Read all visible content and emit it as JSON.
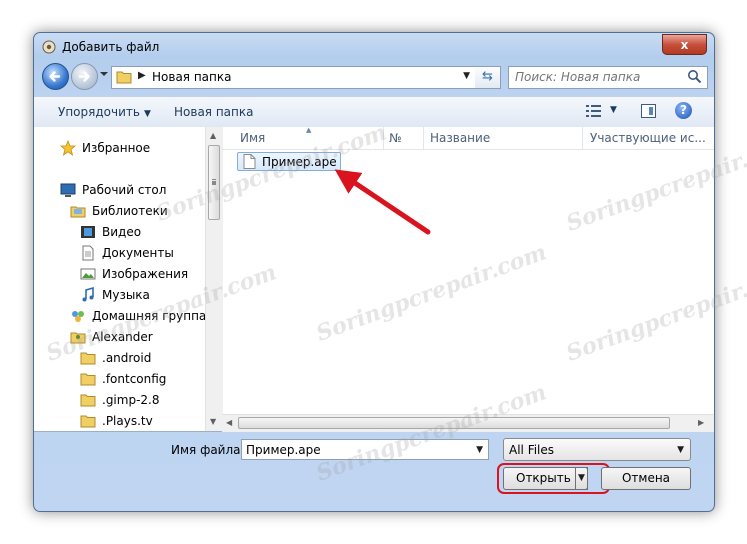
{
  "window": {
    "title": "Добавить файл",
    "close": "x"
  },
  "address": {
    "path": "Новая папка"
  },
  "search": {
    "placeholder": "Поиск: Новая папка"
  },
  "toolbar": {
    "organize": "Упорядочить",
    "new_folder": "Новая папка"
  },
  "nav": {
    "items": [
      {
        "label": "Избранное",
        "icon": "star-icon"
      },
      {
        "label": "Рабочий стол",
        "icon": "desktop-icon"
      },
      {
        "label": "Библиотеки",
        "icon": "libraries-icon"
      },
      {
        "label": "Видео",
        "icon": "video-icon"
      },
      {
        "label": "Документы",
        "icon": "documents-icon"
      },
      {
        "label": "Изображения",
        "icon": "pictures-icon"
      },
      {
        "label": "Музыка",
        "icon": "music-icon"
      },
      {
        "label": "Домашняя группа",
        "icon": "homegroup-icon"
      },
      {
        "label": "Alexander",
        "icon": "user-folder-icon"
      },
      {
        "label": ".android",
        "icon": "folder-icon"
      },
      {
        "label": ".fontconfig",
        "icon": "folder-icon"
      },
      {
        "label": ".gimp-2.8",
        "icon": "folder-icon"
      },
      {
        "label": ".Plays.tv",
        "icon": "folder-icon"
      }
    ]
  },
  "files": {
    "columns": [
      "Имя",
      "№",
      "Название",
      "Участвующие ис..."
    ],
    "items": [
      {
        "name": "Пример.ape"
      }
    ]
  },
  "bottom": {
    "filename_label": "Имя файла:",
    "filename_value": "Пример.ape",
    "filter": "All Files",
    "open": "Открыть",
    "cancel": "Отмена"
  },
  "watermark": "Soringpcrepair.com",
  "colors": {
    "highlight": "#d9141e",
    "selection": "#d7e9fb"
  }
}
